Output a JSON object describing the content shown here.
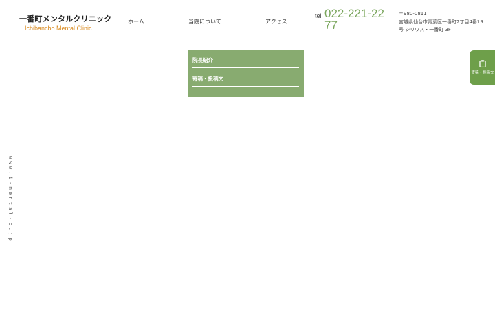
{
  "header": {
    "logo_jp": "一番町メンタルクリニック",
    "logo_en": "Ichibancho Mental Clinic",
    "nav": [
      {
        "label": "ホーム"
      },
      {
        "label": "当院について"
      },
      {
        "label": "アクセス"
      }
    ],
    "tel_label": "tel",
    "tel_dot": ".",
    "tel_number": "022-221-2277",
    "address": {
      "postal": "〒980-0811",
      "line1": "宮城県仙台市青葉区一番町2丁目4番19",
      "line2": "号 シリウス・一番町 3F"
    }
  },
  "dropdown": {
    "items": [
      {
        "label": "院長紹介"
      },
      {
        "label": "寄稿・投稿文"
      }
    ]
  },
  "side_tab": {
    "icon": "clipboard-icon",
    "label": "寄稿・投稿文"
  },
  "vertical_url": "www.i-mental-c.jp",
  "colors": {
    "accent_green": "#79a55b",
    "dropdown_bg": "#88ab70",
    "side_tab_bg": "#6e9f4a",
    "logo_en": "#d98a1e"
  }
}
